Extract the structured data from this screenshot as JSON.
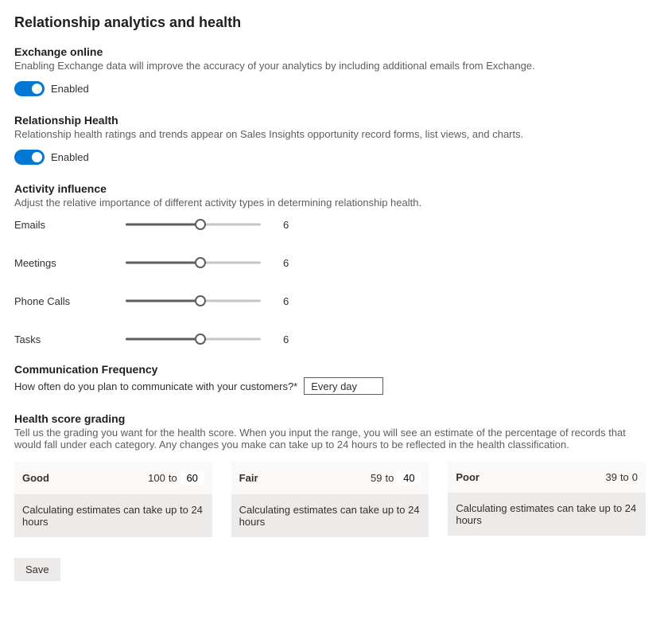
{
  "page_title": "Relationship analytics and health",
  "exchange": {
    "heading": "Exchange online",
    "description": "Enabling Exchange data will improve the accuracy of your analytics by including additional emails from Exchange.",
    "toggle_label": "Enabled"
  },
  "relationship_health": {
    "heading": "Relationship Health",
    "description": "Relationship health ratings and trends appear on Sales Insights opportunity record forms, list views, and charts.",
    "toggle_label": "Enabled"
  },
  "activity_influence": {
    "heading": "Activity influence",
    "description": "Adjust the relative importance of different activity types in determining relationship health.",
    "items": [
      {
        "label": "Emails",
        "value": "6"
      },
      {
        "label": "Meetings",
        "value": "6"
      },
      {
        "label": "Phone Calls",
        "value": "6"
      },
      {
        "label": "Tasks",
        "value": "6"
      }
    ]
  },
  "communication_frequency": {
    "heading": "Communication Frequency",
    "label": "How often do you plan to communicate with your customers?*",
    "value": "Every day"
  },
  "health_grading": {
    "heading": "Health score grading",
    "description": "Tell us the grading you want for the health score. When you input the range, you will see an estimate of the percentage of records that would fall under each category. Any changes you make can take up to 24 hours to be reflected in the health classification.",
    "cards": [
      {
        "name": "Good",
        "high": "100",
        "to": "to",
        "low": "60",
        "note": "Calculating estimates can take up to 24 hours"
      },
      {
        "name": "Fair",
        "high": "59",
        "to": "to",
        "low": "40",
        "note": "Calculating estimates can take up to 24 hours"
      },
      {
        "name": "Poor",
        "high": "39",
        "to": "to",
        "low": "0",
        "note": "Calculating estimates can take up to 24 hours"
      }
    ]
  },
  "save_label": "Save"
}
